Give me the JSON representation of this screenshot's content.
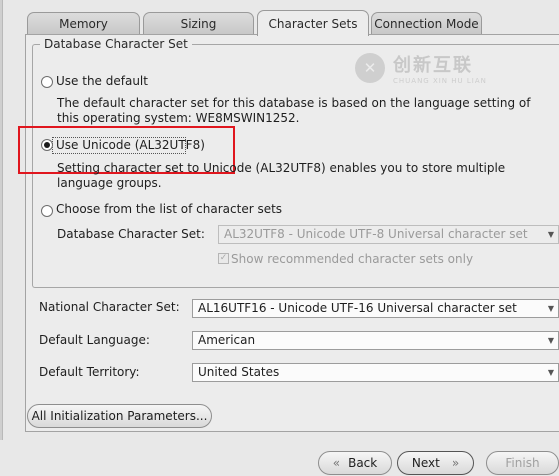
{
  "tabs": [
    {
      "label": "Memory"
    },
    {
      "label": "Sizing"
    },
    {
      "label": "Character Sets",
      "active": true
    },
    {
      "label": "Connection Mode"
    }
  ],
  "db_charset_group": {
    "title": "Database Character Set",
    "options": {
      "default": {
        "label": "Use the default",
        "description": "The default character set for this database is based on the language setting of this operating system: WE8MSWIN1252."
      },
      "unicode": {
        "label": "Use Unicode (AL32UTF8)",
        "description": "Setting character set to Unicode (AL32UTF8) enables you to store multiple language groups.",
        "selected": true
      },
      "list": {
        "label": "Choose from the list of character sets"
      }
    },
    "db_charset_field": {
      "label": "Database Character Set:",
      "value": "AL32UTF8 - Unicode UTF-8 Universal character set"
    },
    "recommended_checkbox": {
      "label": "Show recommended character sets only",
      "checked": true,
      "mark": "✓"
    }
  },
  "national_charset": {
    "label": "National Character Set:",
    "value": "AL16UTF16 - Unicode UTF-16 Universal character set"
  },
  "default_language": {
    "label": "Default Language:",
    "value": "American"
  },
  "default_territory": {
    "label": "Default Territory:",
    "value": "United States"
  },
  "init_params_button": {
    "label": "All Initialization Parameters..."
  },
  "nav": {
    "back_label": "Back",
    "next_label": "Next",
    "finish_label": "Finish",
    "back_icon": "«",
    "next_icon": "»"
  },
  "watermark": {
    "logo_glyph": "✕",
    "main_text": "创新互联",
    "sub_text": "CHUANG XIN HU LIAN"
  },
  "colors": {
    "highlight": "#e0161e",
    "panel": "#ececec"
  }
}
